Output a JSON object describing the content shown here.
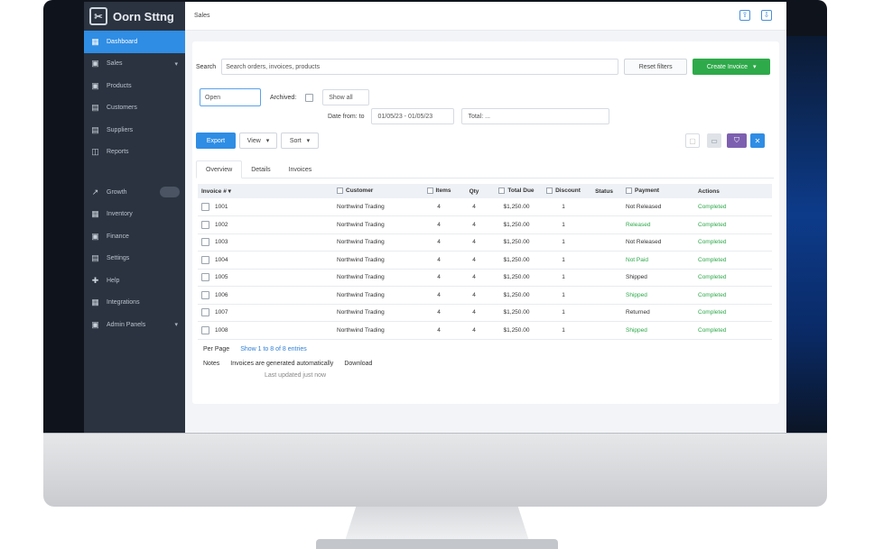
{
  "app": {
    "brand": "Oorn Sttng",
    "page_title": "Sales"
  },
  "sidebar": {
    "items": [
      {
        "label": "Dashboard",
        "icon": "grid-icon",
        "active": true
      },
      {
        "label": "Sales",
        "icon": "box-icon",
        "caret": "▾"
      },
      {
        "label": "Products",
        "icon": "box-icon"
      },
      {
        "label": "Customers",
        "icon": "users-icon"
      },
      {
        "label": "Suppliers",
        "icon": "truck-icon"
      },
      {
        "label": "Reports",
        "icon": "chart-icon"
      }
    ],
    "items2": [
      {
        "label": "Growth",
        "icon": "trend-icon",
        "pill": true
      },
      {
        "label": "Inventory",
        "icon": "box-icon"
      },
      {
        "label": "Finance",
        "icon": "wallet-icon"
      },
      {
        "label": "Settings",
        "icon": "gear-icon"
      },
      {
        "label": "Help",
        "icon": "help-icon"
      },
      {
        "label": "Integrations",
        "icon": "plug-icon"
      },
      {
        "label": "Admin Panels",
        "icon": "shield-icon",
        "caret": "▾"
      }
    ]
  },
  "toolbar": {
    "search_label": "Search",
    "search_value": "Search orders, invoices, products",
    "reset_label": "Reset filters",
    "primary_label": "Create Invoice",
    "primary_caret": "▾"
  },
  "filters": {
    "status_value": "Open",
    "archived_label": "Archived:",
    "show_all_label": "Show all",
    "date_label": "Date from: to",
    "date_range": "01/05/23 - 01/05/23",
    "total_value": "Total: ..."
  },
  "actions": {
    "export_label": "Export",
    "view_label": "View",
    "sort_label": "Sort"
  },
  "tabs": [
    "Overview",
    "Details",
    "Invoices"
  ],
  "table": {
    "headers": [
      "Invoice #",
      "Customer",
      "Items",
      "Qty",
      "Total Due",
      "Discount",
      "Status",
      "Payment",
      "Actions"
    ],
    "rows": [
      [
        "1001",
        "Northwind Trading",
        "4",
        "4",
        "$1,250.00",
        "1",
        "Not Released",
        "Completed"
      ],
      [
        "1002",
        "Northwind Trading",
        "4",
        "4",
        "$1,250.00",
        "1",
        "Released",
        "Completed"
      ],
      [
        "1003",
        "Northwind Trading",
        "4",
        "4",
        "$1,250.00",
        "1",
        "Not Released",
        "Completed"
      ],
      [
        "1004",
        "Northwind Trading",
        "4",
        "4",
        "$1,250.00",
        "1",
        "Not Paid",
        "Completed"
      ],
      [
        "1005",
        "Northwind Trading",
        "4",
        "4",
        "$1,250.00",
        "1",
        "Shipped",
        "Completed"
      ],
      [
        "1006",
        "Northwind Trading",
        "4",
        "4",
        "$1,250.00",
        "1",
        "Shipped",
        "Completed"
      ],
      [
        "1007",
        "Northwind Trading",
        "4",
        "4",
        "$1,250.00",
        "1",
        "Returned",
        "Completed"
      ],
      [
        "1008",
        "Northwind Trading",
        "4",
        "4",
        "$1,250.00",
        "1",
        "Shipped",
        "Completed"
      ]
    ]
  },
  "footer": {
    "label1": "Per Page",
    "link1": "Show 1 to 8 of 8 entries",
    "label2": "Notes",
    "text2": "Invoices are generated automatically",
    "text3": "Download",
    "muted": "Last updated just now"
  },
  "colors": {
    "accent": "#2f8de4",
    "success": "#2eaa4a",
    "sidebar": "#2b3340"
  }
}
